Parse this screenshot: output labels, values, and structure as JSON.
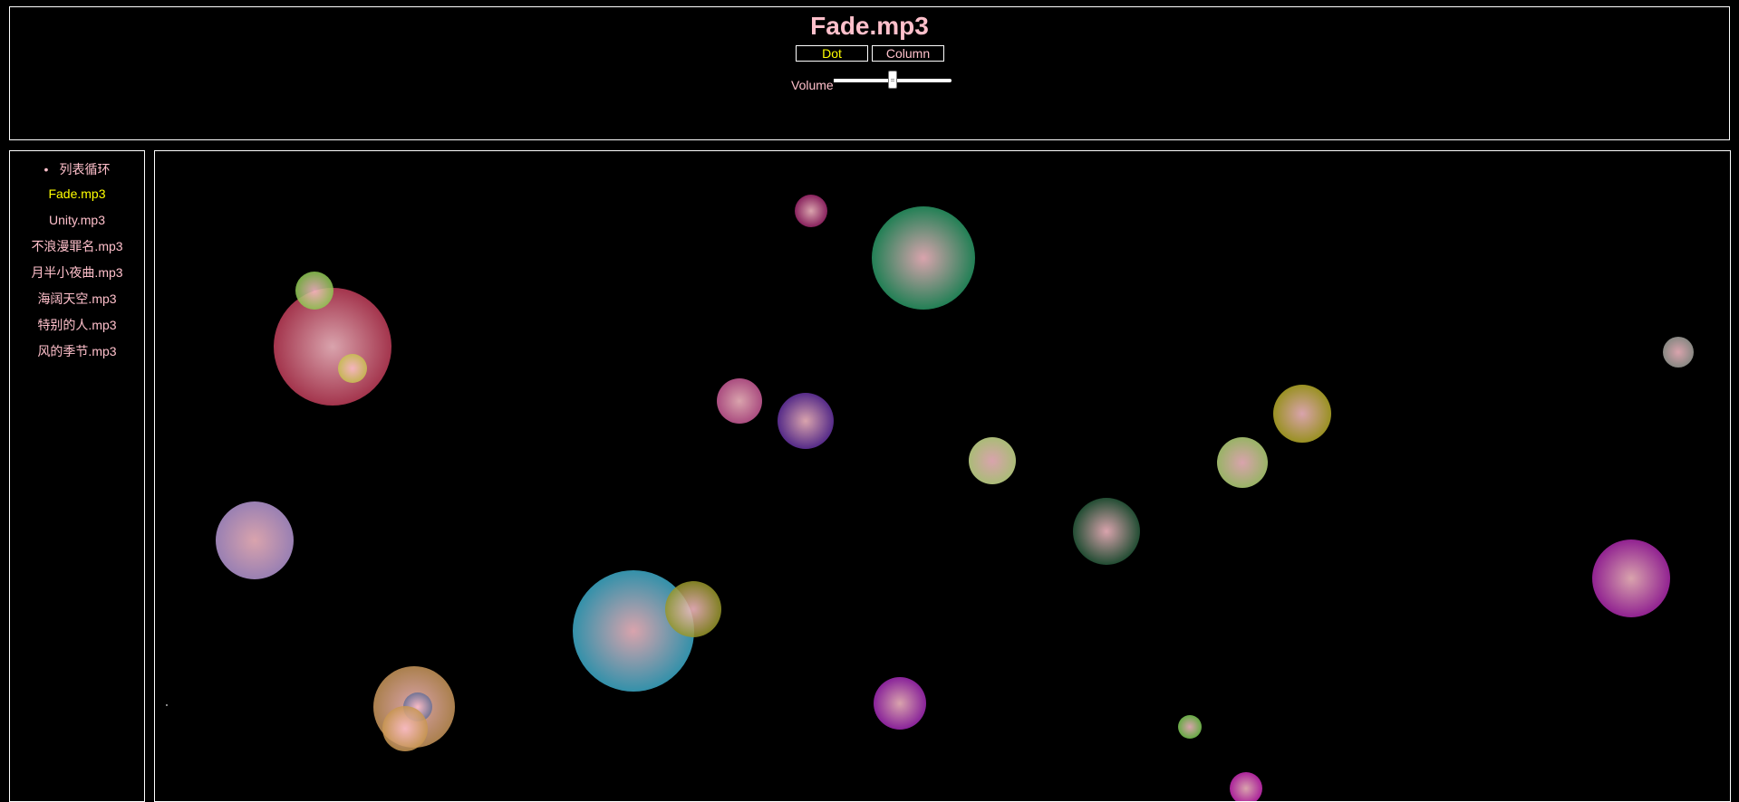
{
  "header": {
    "title": "Fade.mp3",
    "buttons": [
      {
        "label": "Dot",
        "selected": true
      },
      {
        "label": "Column",
        "selected": false
      }
    ],
    "volume": {
      "label": "Volume",
      "value": 0.5
    }
  },
  "sidebar": {
    "mode_label": "列表循环",
    "items": [
      {
        "label": "Fade.mp3",
        "active": true
      },
      {
        "label": "Unity.mp3",
        "active": false
      },
      {
        "label": "不浪漫罪名.mp3",
        "active": false
      },
      {
        "label": "月半小夜曲.mp3",
        "active": false
      },
      {
        "label": "海阔天空.mp3",
        "active": false
      },
      {
        "label": "特别的人.mp3",
        "active": false
      },
      {
        "label": "风的季节.mp3",
        "active": false
      }
    ]
  },
  "visualizer": {
    "mode": "dot",
    "center_color": "#ffc0cb",
    "dot_colors": [
      "#c03e5a",
      "#8cc850",
      "#c8c350",
      "#a0286e",
      "#289664",
      "#c85a96",
      "#6432a0",
      "#c8dc8c",
      "#b4d278",
      "#b4aa28",
      "#a0a09a",
      "#b496d2",
      "#285a3c",
      "#aa28aa",
      "#3caac8",
      "#969628",
      "#c8965a",
      "#646e96",
      "#a028b4",
      "#78c850",
      "#c828b4",
      "#c89650"
    ]
  }
}
